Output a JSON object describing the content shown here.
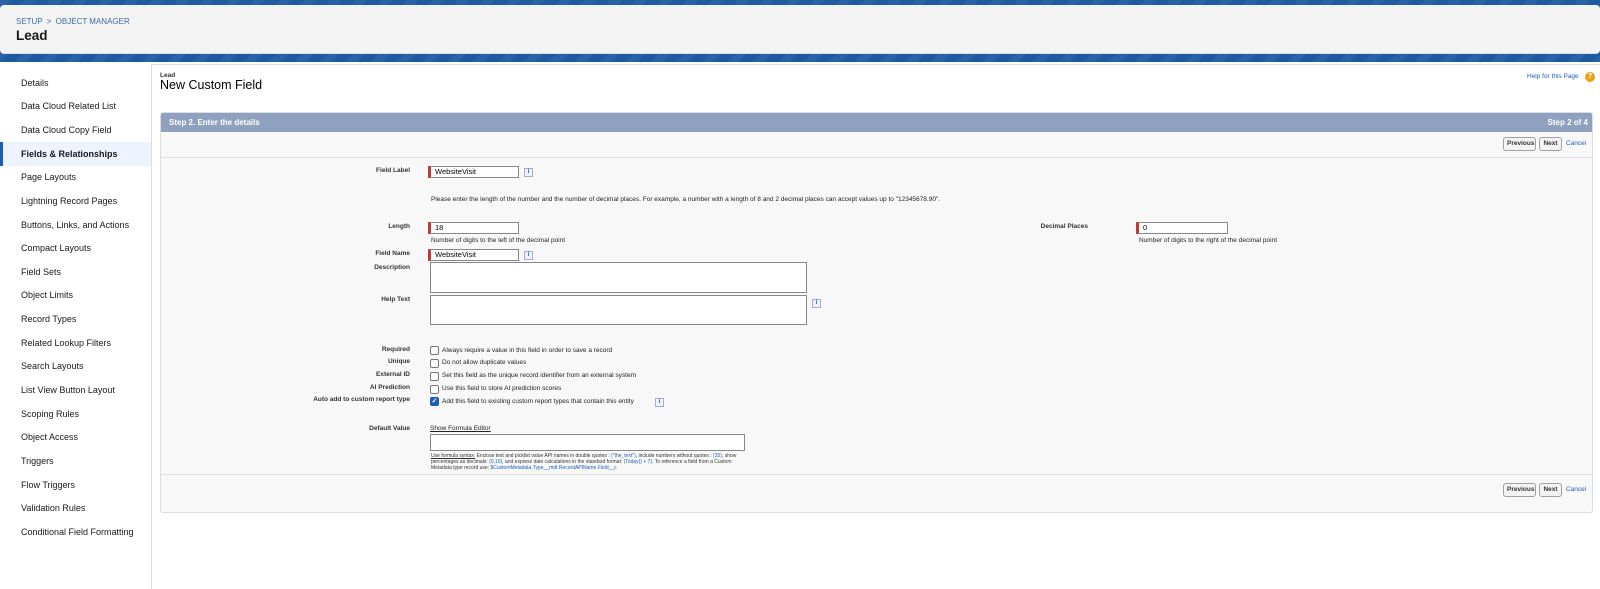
{
  "header": {
    "breadcrumb": [
      "SETUP",
      "OBJECT MANAGER"
    ],
    "breadcrumb_separator": ">",
    "title": "Lead"
  },
  "sidebar": {
    "items": [
      {
        "label": "Details"
      },
      {
        "label": "Data Cloud Related List"
      },
      {
        "label": "Data Cloud Copy Field"
      },
      {
        "label": "Fields & Relationships",
        "active": true
      },
      {
        "label": "Page Layouts"
      },
      {
        "label": "Lightning Record Pages"
      },
      {
        "label": "Buttons, Links, and Actions"
      },
      {
        "label": "Compact Layouts"
      },
      {
        "label": "Field Sets"
      },
      {
        "label": "Object Limits"
      },
      {
        "label": "Record Types"
      },
      {
        "label": "Related Lookup Filters"
      },
      {
        "label": "Search Layouts"
      },
      {
        "label": "List View Button Layout"
      },
      {
        "label": "Scoping Rules"
      },
      {
        "label": "Object Access"
      },
      {
        "label": "Triggers"
      },
      {
        "label": "Flow Triggers"
      },
      {
        "label": "Validation Rules"
      },
      {
        "label": "Conditional Field Formatting"
      }
    ]
  },
  "content": {
    "object_label": "Lead",
    "title": "New Custom Field",
    "help_link": "Help for this Page",
    "help_icon": "?"
  },
  "step": {
    "title": "Step 2. Enter the details",
    "count": "Step 2 of 4"
  },
  "buttons": {
    "previous": "Previous",
    "next": "Next",
    "cancel": "Cancel"
  },
  "form": {
    "field_label": {
      "label": "Field Label",
      "value": "WebsiteVisit"
    },
    "length_instructions": "Please enter the length of the number and the number of decimal places. For example, a number with a length of 8 and 2 decimal places can accept values up to \"12345678.90\".",
    "length": {
      "label": "Length",
      "value": "18",
      "note": "Number of digits to the left of the decimal point"
    },
    "decimal_places": {
      "label": "Decimal Places",
      "value": "0",
      "note": "Number of digits to the right of the decimal point"
    },
    "field_name": {
      "label": "Field Name",
      "value": "WebsiteVisit"
    },
    "description": {
      "label": "Description",
      "value": ""
    },
    "help_text": {
      "label": "Help Text",
      "value": ""
    },
    "required": {
      "label": "Required",
      "text": "Always require a value in this field in order to save a record",
      "checked": false
    },
    "unique": {
      "label": "Unique",
      "text": "Do not allow duplicate values",
      "checked": false
    },
    "external_id": {
      "label": "External ID",
      "text": "Set this field as the unique record identifier from an external system",
      "checked": false
    },
    "ai_prediction": {
      "label": "AI Prediction",
      "text": "Use this field to store AI prediction scores",
      "checked": false
    },
    "auto_add": {
      "label": "Auto add to custom report type",
      "text": "Add this field to existing custom report types that contain this entity",
      "checked": true
    },
    "default_value": {
      "label": "Default Value",
      "formula_link": "Show Formula Editor",
      "value": "",
      "hint_1": "Use formula syntax:",
      "hint_2": "Enclose text and picklist value API names in double quotes : ",
      "hint_3": "(\"the_text\")",
      "hint_4": ", include numbers without quotes : ",
      "hint_5": "(25)",
      "hint_6": ", show percentages as decimals: ",
      "hint_7": "(0.10)",
      "hint_8": ", and express date calculations in the standard format: ",
      "hint_9": "(Today() + 7)",
      "hint_10": ". To reference a field from a Custom Metadata type record use: ",
      "hint_11": "$CustomMetadata.Type__mdt.RecordAPIName.Field__c"
    }
  },
  "icons": {
    "info": "i",
    "grammarly_bulb": "●",
    "grammarly_g": "G",
    "check": "✓"
  }
}
